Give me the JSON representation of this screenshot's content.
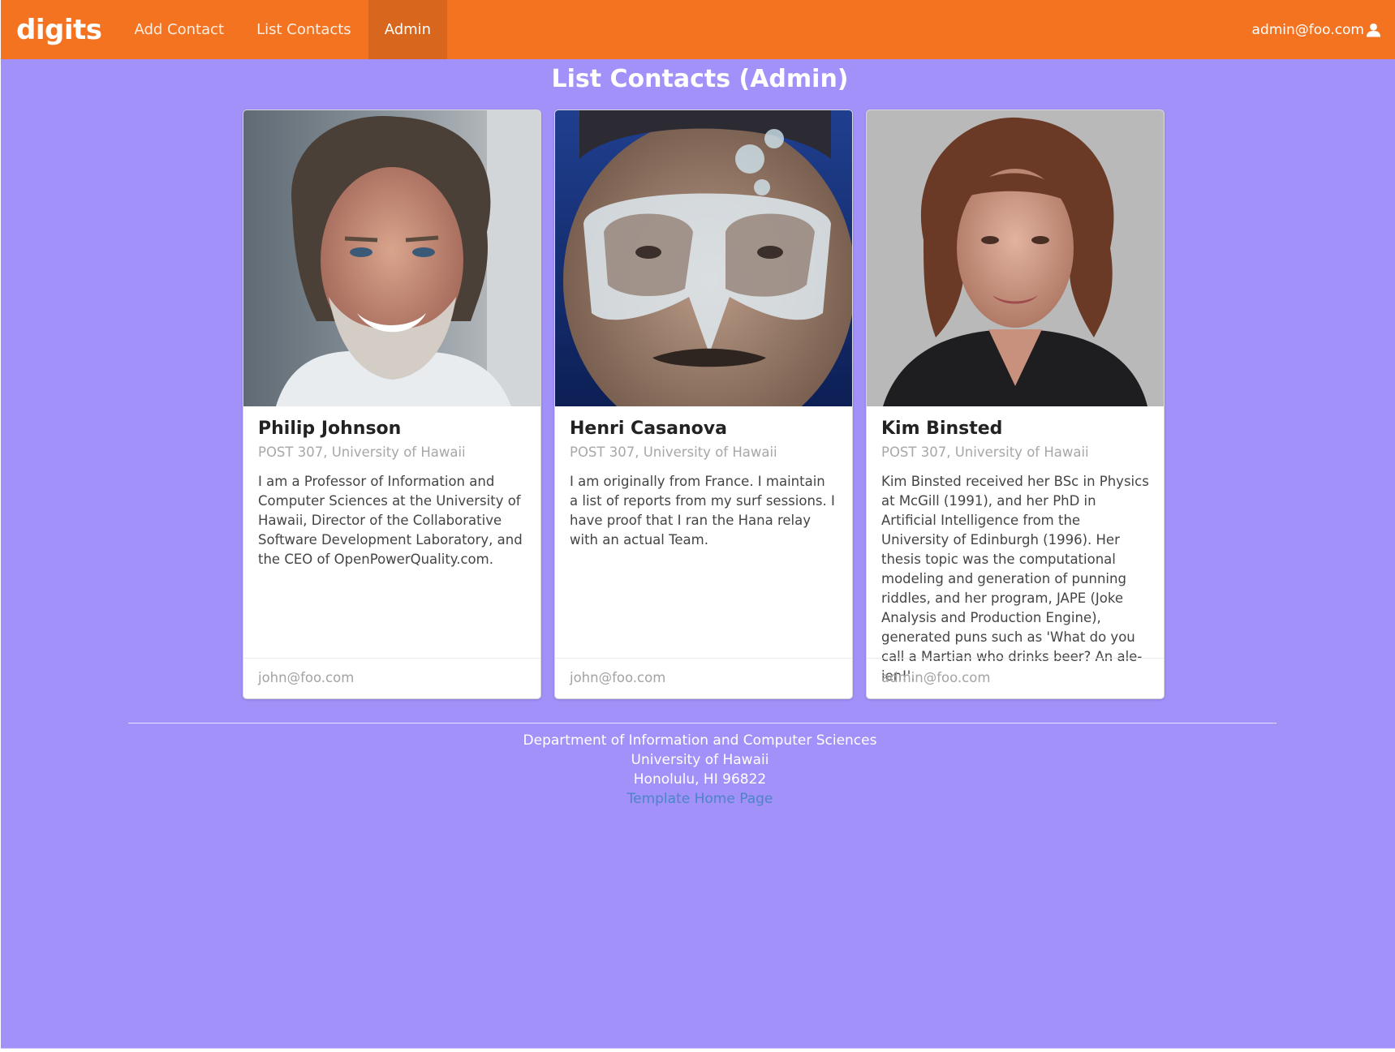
{
  "navbar": {
    "brand": "digits",
    "links": [
      "Add Contact",
      "List Contacts",
      "Admin"
    ],
    "active": "Admin",
    "user": "admin@foo.com",
    "user_icon": "user-icon"
  },
  "page": {
    "title": "List Contacts (Admin)"
  },
  "contacts": [
    {
      "name": "Philip Johnson",
      "address": "POST 307, University of Hawaii",
      "description": "I am a Professor of Information and Computer Sciences at the University of Hawaii, Director of the Collaborative Software Development Laboratory, and the CEO of OpenPowerQuality.com.",
      "owner": "john@foo.com",
      "photo": "portrait of a smiling man with grey beard"
    },
    {
      "name": "Henri Casanova",
      "address": "POST 307, University of Hawaii",
      "description": "I am originally from France. I maintain a list of reports from my surf sessions. I have proof that I ran the Hana relay with an actual Team.",
      "owner": "john@foo.com",
      "photo": "man underwater wearing a diving mask"
    },
    {
      "name": "Kim Binsted",
      "address": "POST 307, University of Hawaii",
      "description": "Kim Binsted received her BSc in Physics at McGill (1991), and her PhD in Artificial Intelligence from the University of Edinburgh (1996). Her thesis topic was the computational modeling and generation of punning riddles, and her program, JAPE (Joke Analysis and Production Engine), generated puns such as 'What do you call a Martian who drinks beer? An ale-ien!'.",
      "owner": "admin@foo.com",
      "photo": "portrait of a woman with curly brown hair"
    }
  ],
  "footer": {
    "lines": [
      "Department of Information and Computer Sciences",
      "University of Hawaii",
      "Honolulu, HI 96822"
    ],
    "link": "Template Home Page"
  },
  "colors": {
    "navbar": "#f37321",
    "navbar_active": "#d9661d",
    "background": "#a291f9",
    "link": "#4c84c8"
  }
}
